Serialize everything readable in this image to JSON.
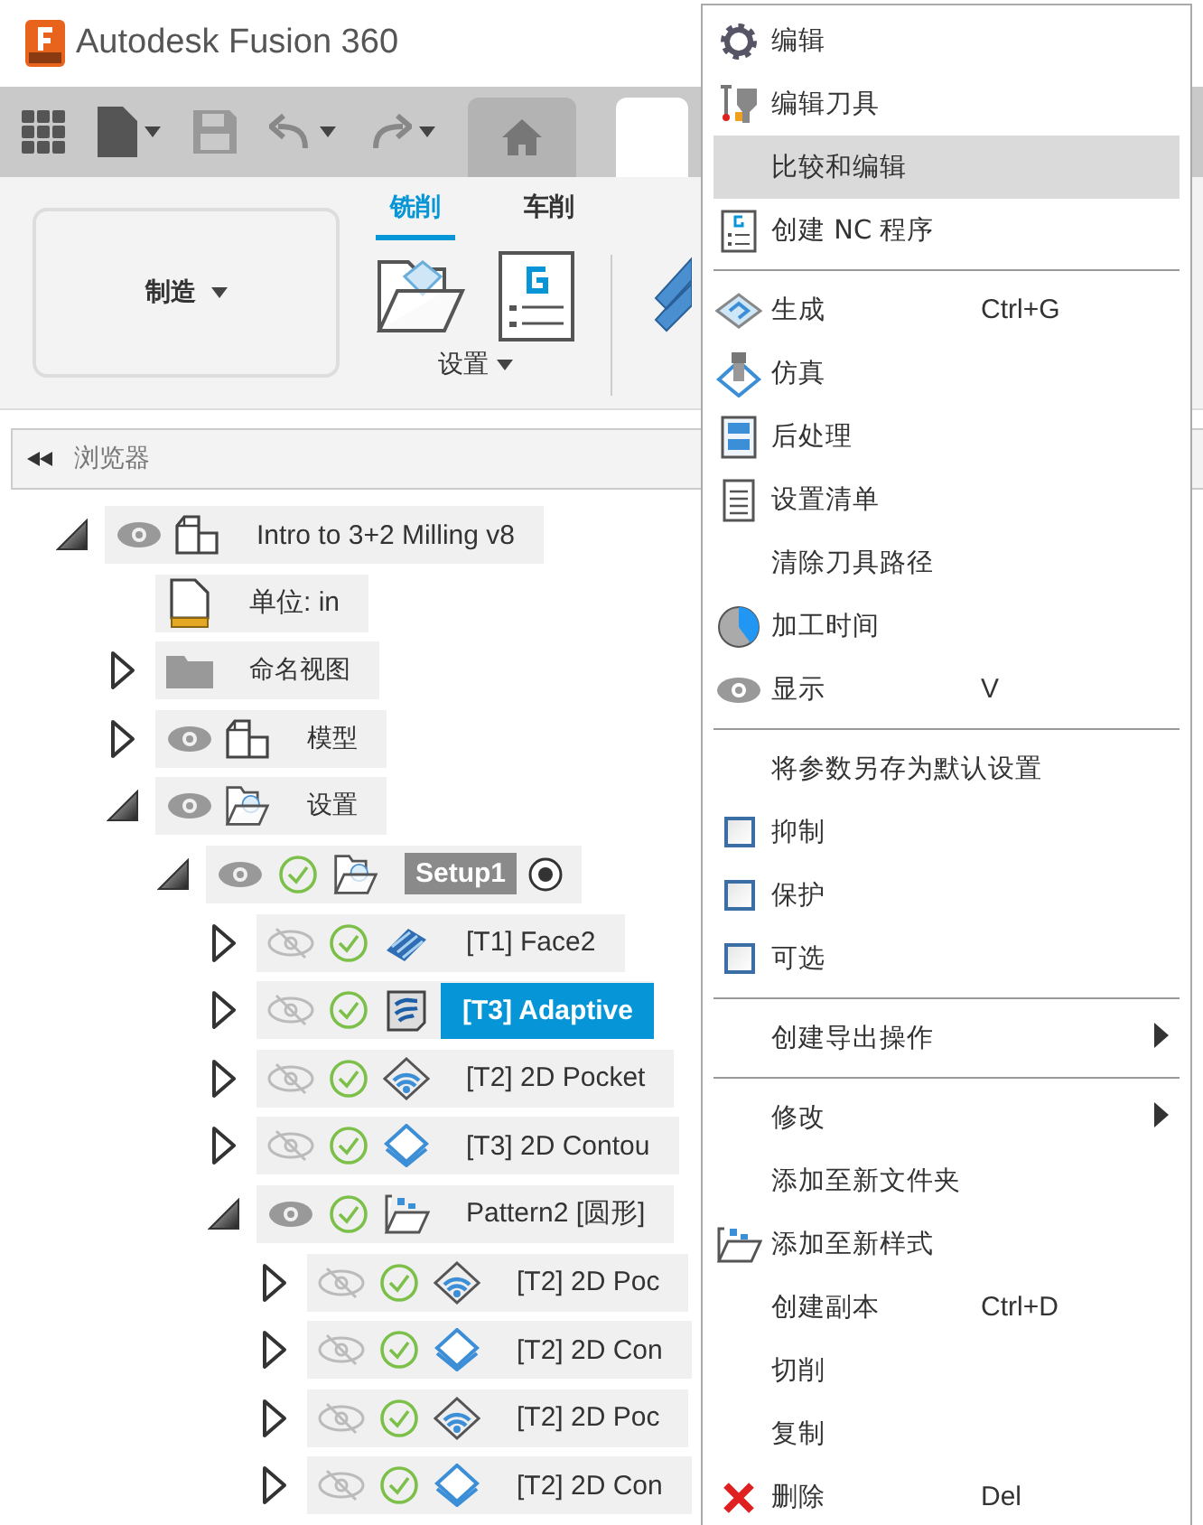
{
  "app": {
    "title": "Autodesk Fusion 360"
  },
  "ribbon": {
    "workspace": "制造",
    "tabs": [
      {
        "label": "铣削",
        "selected": true
      },
      {
        "label": "车削",
        "selected": false
      }
    ],
    "group_label": "设置"
  },
  "browser": {
    "title": "浏览器",
    "tree": [
      {
        "label": "Intro to 3+2 Milling v8",
        "expanded": true,
        "visible": true,
        "kind": "component",
        "selected": false,
        "children": [
          {
            "label": "单位: in",
            "kind": "units",
            "selected": false
          },
          {
            "label": "命名视图",
            "expanded": false,
            "kind": "folder",
            "selected": false
          },
          {
            "label": "模型",
            "expanded": false,
            "visible": true,
            "kind": "component",
            "selected": false
          },
          {
            "label": "设置",
            "expanded": true,
            "visible": true,
            "kind": "setup",
            "selected": false,
            "children": [
              {
                "label": "Setup1",
                "expanded": true,
                "visible": true,
                "done": true,
                "kind": "setup",
                "selected": false,
                "active": true,
                "children": [
                  {
                    "label": "[T1] Face2",
                    "expanded": false,
                    "visible": false,
                    "done": true,
                    "kind": "face",
                    "selected": false
                  },
                  {
                    "label": "[T3] Adaptive",
                    "expanded": false,
                    "visible": false,
                    "done": true,
                    "kind": "adaptive",
                    "selected": true
                  },
                  {
                    "label": "[T2] 2D Pocket",
                    "expanded": false,
                    "visible": false,
                    "done": true,
                    "kind": "pocket",
                    "selected": false
                  },
                  {
                    "label": "[T3] 2D Contou",
                    "expanded": false,
                    "visible": false,
                    "done": true,
                    "kind": "contour",
                    "selected": false
                  },
                  {
                    "label": "Pattern2 [圆形]",
                    "expanded": true,
                    "visible": true,
                    "done": true,
                    "kind": "pattern",
                    "selected": false,
                    "children": [
                      {
                        "label": "[T2] 2D Poc",
                        "expanded": false,
                        "visible": false,
                        "done": true,
                        "kind": "pocket",
                        "selected": false
                      },
                      {
                        "label": "[T2] 2D Con",
                        "expanded": false,
                        "visible": false,
                        "done": true,
                        "kind": "contour",
                        "selected": false
                      },
                      {
                        "label": "[T2] 2D Poc",
                        "expanded": false,
                        "visible": false,
                        "done": true,
                        "kind": "pocket",
                        "selected": false
                      },
                      {
                        "label": "[T2] 2D Con",
                        "expanded": false,
                        "visible": false,
                        "done": true,
                        "kind": "contour",
                        "selected": false
                      }
                    ]
                  }
                ]
              }
            ]
          }
        ]
      }
    ]
  },
  "context_menu": {
    "items": [
      {
        "label": "编辑",
        "kind": "gear",
        "selected": false
      },
      {
        "label": "编辑刀具",
        "kind": "tool",
        "selected": false
      },
      {
        "label": "比较和编辑",
        "kind": "plain",
        "selected": true
      },
      {
        "label": "创建 NC 程序",
        "kind": "nc",
        "selected": false
      },
      {
        "kind": "separator"
      },
      {
        "label": "生成",
        "kind": "generate",
        "shortcut": "Ctrl+G",
        "selected": false
      },
      {
        "label": "仿真",
        "kind": "simulate",
        "selected": false
      },
      {
        "label": "后处理",
        "kind": "post",
        "selected": false
      },
      {
        "label": "设置清单",
        "kind": "sheet",
        "selected": false
      },
      {
        "label": "清除刀具路径",
        "kind": "plain",
        "selected": false
      },
      {
        "label": "加工时间",
        "kind": "pie",
        "selected": false
      },
      {
        "label": "显示",
        "kind": "eye",
        "shortcut": "V",
        "selected": false
      },
      {
        "kind": "separator"
      },
      {
        "label": "将参数另存为默认设置",
        "kind": "plain",
        "selected": false
      },
      {
        "label": "抑制",
        "kind": "checkbox",
        "checked": false,
        "selected": false
      },
      {
        "label": "保护",
        "kind": "checkbox",
        "checked": false,
        "selected": false
      },
      {
        "label": "可选",
        "kind": "checkbox",
        "checked": false,
        "selected": false
      },
      {
        "kind": "separator"
      },
      {
        "label": "创建导出操作",
        "kind": "plain",
        "submenu": true,
        "selected": false
      },
      {
        "kind": "separator"
      },
      {
        "label": "修改",
        "kind": "plain",
        "submenu": true,
        "selected": false
      },
      {
        "label": "添加至新文件夹",
        "kind": "plain",
        "selected": false
      },
      {
        "label": "添加至新样式",
        "kind": "pattern",
        "selected": false
      },
      {
        "label": "创建副本",
        "kind": "plain",
        "shortcut": "Ctrl+D",
        "selected": false
      },
      {
        "label": "切削",
        "kind": "plain",
        "selected": false
      },
      {
        "label": "复制",
        "kind": "plain",
        "selected": false
      },
      {
        "label": "删除",
        "kind": "delete",
        "shortcut": "Del",
        "selected": false
      }
    ]
  }
}
